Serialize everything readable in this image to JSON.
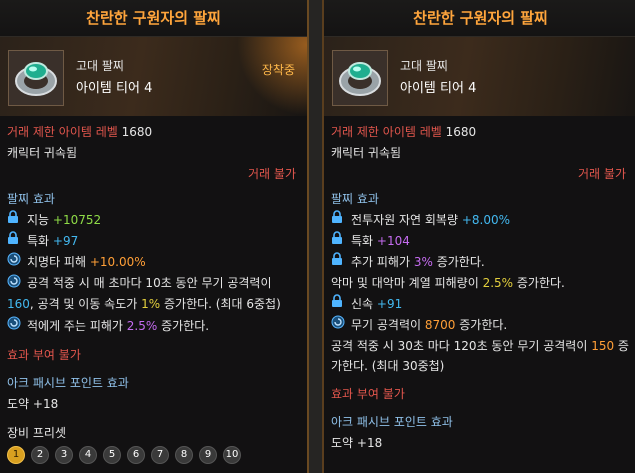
{
  "left": {
    "title": "찬란한 구원자의 팔찌",
    "grade": "고대 팔찌",
    "tier": "아이템 티어 4",
    "equipped": "장착중",
    "trade_limit_label": "거래 제한 아이템 레벨",
    "trade_limit_value": "1680",
    "bound": "캐릭터 귀속됨",
    "untradable": "거래 불가",
    "effect_header": "팔찌 효과",
    "stats": [
      {
        "label": "지능",
        "value": "+10752"
      },
      {
        "label": "특화",
        "value": "+97"
      }
    ],
    "crit_label": "치명타 피해",
    "crit_value": "+10.00%",
    "effect1_a": "공격 적중 시 매 초마다 10초 동안 무기 공격력이 ",
    "effect1_b": "160",
    "effect1_c": ", 공격 및 이동 속도가 ",
    "effect1_d": "1%",
    "effect1_e": " 증가한다. (최대 6중첩)",
    "effect2_a": "적에게 주는 피해가 ",
    "effect2_b": "2.5%",
    "effect2_c": " 증가한다.",
    "no_grant": "효과 부여 불가",
    "ark_header": "아크 패시브 포인트 효과",
    "ark_value": "도약 +18",
    "preset_header": "장비 프리셋",
    "presets": [
      "1",
      "2",
      "3",
      "4",
      "5",
      "6",
      "7",
      "8",
      "9",
      "10"
    ]
  },
  "right": {
    "title": "찬란한 구원자의 팔찌",
    "grade": "고대 팔찌",
    "tier": "아이템 티어 4",
    "trade_limit_label": "거래 제한 아이템 레벨",
    "trade_limit_value": "1680",
    "bound": "캐릭터 귀속됨",
    "untradable": "거래 불가",
    "effect_header": "팔찌 효과",
    "line1_label": "전투자원 자연 회복량",
    "line1_value": "+8.00%",
    "line2_label": "특화",
    "line2_value": "+104",
    "line3_a": "추가 피해가 ",
    "line3_b": "3%",
    "line3_c": " 증가한다.",
    "line4_a": "악마 및 대악마 계열 피해량이 ",
    "line4_b": "2.5%",
    "line4_c": " 증가한다.",
    "line5_label": "신속",
    "line5_value": "+91",
    "line6_a": "무기 공격력이 ",
    "line6_b": "8700",
    "line6_c": " 증가한다.",
    "line7_a": "공격 적중 시 30초 마다 120초 동안 무기 공격력이 ",
    "line7_b": "150",
    "line7_c": " 증가한다. (최대 30중첩)",
    "no_grant": "효과 부여 불가",
    "ark_header": "아크 패시브 포인트 효과",
    "ark_value": "도약 +18"
  },
  "colors": {
    "title": "#ffa53c",
    "red": "#e2564d",
    "green": "#8fdc47",
    "cyan": "#43b8ef",
    "purple": "#c56cf0",
    "orange": "#ff9f37"
  }
}
